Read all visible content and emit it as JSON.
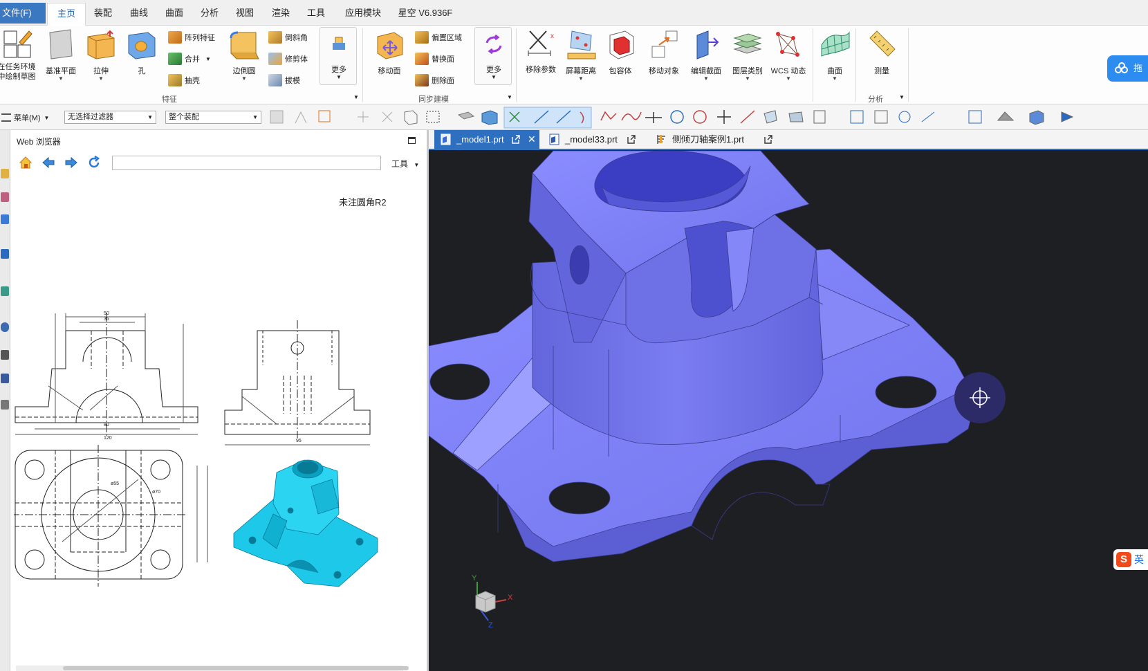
{
  "menu": {
    "file": "文件(F)",
    "tabs": [
      "主页",
      "装配",
      "曲线",
      "曲面",
      "分析",
      "视图",
      "渲染",
      "工具",
      "应用模块",
      "星空 V6.936F"
    ]
  },
  "ribbon": {
    "task_env": "在任务环境中绘制草图",
    "datum_plane": "基准平面",
    "extrude": "拉伸",
    "hole": "孔",
    "pattern_feature": "阵列特征",
    "unite": "合并",
    "shell": "抽壳",
    "edge_blend": "边倒圆",
    "chamfer": "倒斜角",
    "trim_body": "修剪体",
    "draft": "拔模",
    "more1": "更多",
    "group_feature": "特征",
    "move_face": "移动面",
    "offset_region": "偏置区域",
    "replace_face": "替换面",
    "delete_face": "删除面",
    "more2": "更多",
    "group_sync": "同步建模",
    "remove_params": "移除参数",
    "screen_distance": "屏幕距离",
    "bounding_body": "包容体",
    "move_object": "移动对象",
    "edit_section": "编辑截面",
    "layer_category": "图层类别",
    "wcs_dynamic": "WCS 动态",
    "surface": "曲面",
    "measure": "测量",
    "group_analysis": "分析",
    "cloud_label": "拖"
  },
  "toolbar": {
    "menu_label": "菜单(M)",
    "filter_value": "无选择过滤器",
    "scope_value": "整个装配"
  },
  "browser": {
    "title": "Web 浏览器",
    "url": "",
    "tools": "工具",
    "drawing_note": "未注圆角R2"
  },
  "doc_tabs": [
    {
      "label": "_model1.prt",
      "active": true
    },
    {
      "label": "_model33.prt",
      "active": false
    },
    {
      "label": "侧倾刀轴案例1.prt",
      "active": false
    }
  ],
  "triad": {
    "x": "X",
    "y": "Y",
    "z": "Z"
  },
  "ime_label": "英",
  "colors": {
    "accent": "#2f6fc0",
    "file_tab": "#3a78c2",
    "viewport_bg": "#1d1f22",
    "part_color": "#7b7ef0",
    "preview_part": "#1ec8e8"
  }
}
